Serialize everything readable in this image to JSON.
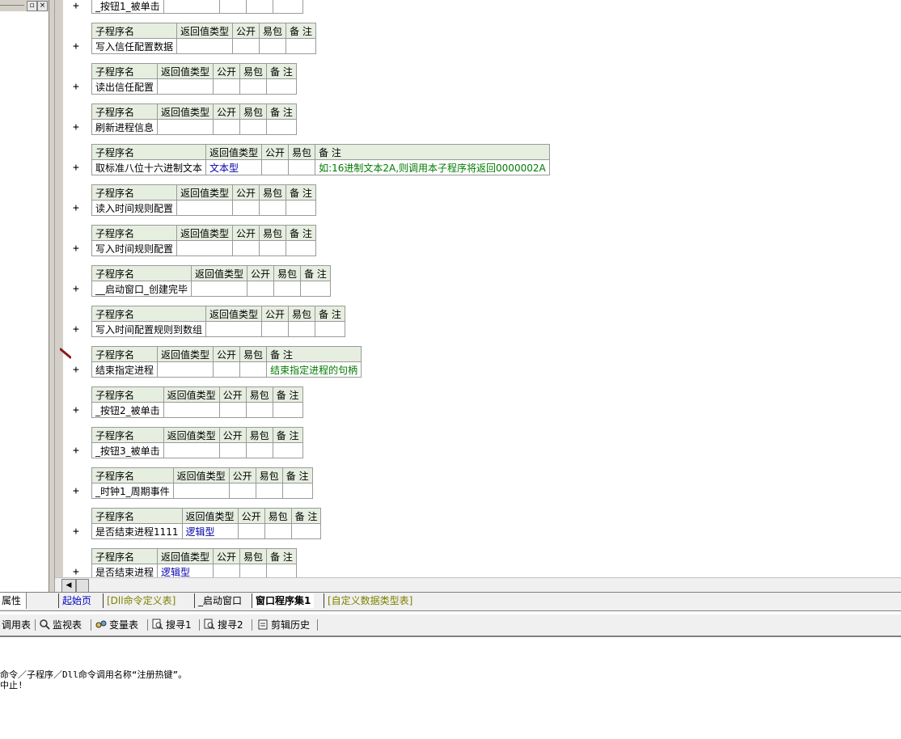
{
  "left_panel": {
    "prop_tab": "属性"
  },
  "table_headers": {
    "name": "子程序名",
    "return_type": "返回值类型",
    "public": "公开",
    "easy_pack": "易包",
    "note": "备 注"
  },
  "subroutines": [
    {
      "name": "_按钮1_被单击",
      "return_type": "",
      "note": ""
    },
    {
      "name": "写入信任配置数据",
      "return_type": "",
      "note": ""
    },
    {
      "name": "读出信任配置",
      "return_type": "",
      "note": ""
    },
    {
      "name": "刷新进程信息",
      "return_type": "",
      "note": ""
    },
    {
      "name": "取标准八位十六进制文本",
      "return_type": "文本型",
      "note": "如:16进制文本2A,则调用本子程序将返回0000002A"
    },
    {
      "name": "读入时间规则配置",
      "return_type": "",
      "note": ""
    },
    {
      "name": "写入时间规则配置",
      "return_type": "",
      "note": ""
    },
    {
      "name": "__启动窗口_创建完毕",
      "return_type": "",
      "note": ""
    },
    {
      "name": "写入时间配置规则到数组",
      "return_type": "",
      "note": ""
    },
    {
      "name": "结束指定进程",
      "return_type": "",
      "note": "结束指定进程的句柄"
    },
    {
      "name": "_按钮2_被单击",
      "return_type": "",
      "note": ""
    },
    {
      "name": "_按钮3_被单击",
      "return_type": "",
      "note": ""
    },
    {
      "name": "_时钟1_周期事件",
      "return_type": "",
      "note": ""
    },
    {
      "name": "是否结束进程1111",
      "return_type": "逻辑型",
      "note": ""
    },
    {
      "name": "是否结束进程",
      "return_type": "逻辑型",
      "note": ""
    }
  ],
  "tabs": [
    {
      "label": "起始页",
      "color": "#0000c0"
    },
    {
      "label": "[Dll命令定义表]",
      "color": "#808000"
    },
    {
      "label": "_启动窗口",
      "color": "#000000"
    },
    {
      "label": "窗口程序集1",
      "color": "#000000",
      "active": true
    },
    {
      "label": "[自定义数据类型表]",
      "color": "#808000"
    }
  ],
  "toolbar": [
    {
      "label": "调用表",
      "icon": "table-icon"
    },
    {
      "label": "监视表",
      "icon": "magnifier-icon"
    },
    {
      "label": "变量表",
      "icon": "variables-icon"
    },
    {
      "label": "搜寻1",
      "icon": "search-doc-icon"
    },
    {
      "label": "搜寻2",
      "icon": "search-doc-icon"
    },
    {
      "label": "剪辑历史",
      "icon": "clipboard-icon"
    }
  ],
  "output": {
    "line1": "命令／子程序／Dll命令调用名称“注册热键”。",
    "line2": "中止!"
  }
}
